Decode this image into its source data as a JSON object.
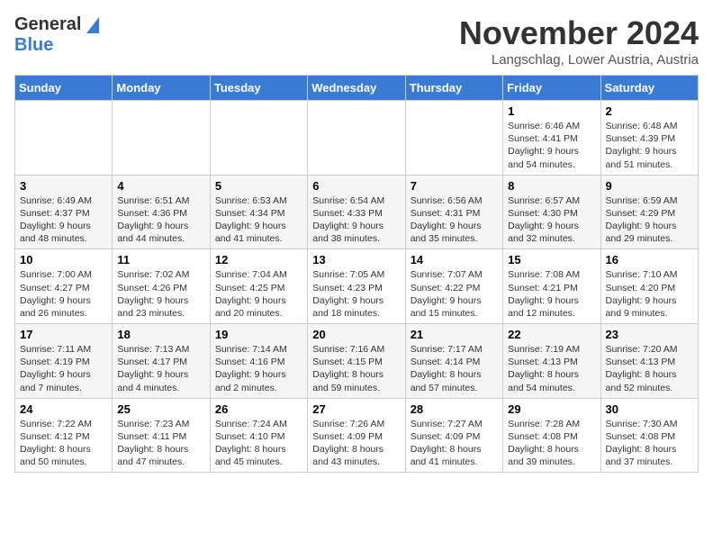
{
  "header": {
    "logo_general": "General",
    "logo_blue": "Blue",
    "month": "November 2024",
    "location": "Langschlag, Lower Austria, Austria"
  },
  "days_of_week": [
    "Sunday",
    "Monday",
    "Tuesday",
    "Wednesday",
    "Thursday",
    "Friday",
    "Saturday"
  ],
  "weeks": [
    [
      {
        "day": "",
        "info": ""
      },
      {
        "day": "",
        "info": ""
      },
      {
        "day": "",
        "info": ""
      },
      {
        "day": "",
        "info": ""
      },
      {
        "day": "",
        "info": ""
      },
      {
        "day": "1",
        "info": "Sunrise: 6:46 AM\nSunset: 4:41 PM\nDaylight: 9 hours\nand 54 minutes."
      },
      {
        "day": "2",
        "info": "Sunrise: 6:48 AM\nSunset: 4:39 PM\nDaylight: 9 hours\nand 51 minutes."
      }
    ],
    [
      {
        "day": "3",
        "info": "Sunrise: 6:49 AM\nSunset: 4:37 PM\nDaylight: 9 hours\nand 48 minutes."
      },
      {
        "day": "4",
        "info": "Sunrise: 6:51 AM\nSunset: 4:36 PM\nDaylight: 9 hours\nand 44 minutes."
      },
      {
        "day": "5",
        "info": "Sunrise: 6:53 AM\nSunset: 4:34 PM\nDaylight: 9 hours\nand 41 minutes."
      },
      {
        "day": "6",
        "info": "Sunrise: 6:54 AM\nSunset: 4:33 PM\nDaylight: 9 hours\nand 38 minutes."
      },
      {
        "day": "7",
        "info": "Sunrise: 6:56 AM\nSunset: 4:31 PM\nDaylight: 9 hours\nand 35 minutes."
      },
      {
        "day": "8",
        "info": "Sunrise: 6:57 AM\nSunset: 4:30 PM\nDaylight: 9 hours\nand 32 minutes."
      },
      {
        "day": "9",
        "info": "Sunrise: 6:59 AM\nSunset: 4:29 PM\nDaylight: 9 hours\nand 29 minutes."
      }
    ],
    [
      {
        "day": "10",
        "info": "Sunrise: 7:00 AM\nSunset: 4:27 PM\nDaylight: 9 hours\nand 26 minutes."
      },
      {
        "day": "11",
        "info": "Sunrise: 7:02 AM\nSunset: 4:26 PM\nDaylight: 9 hours\nand 23 minutes."
      },
      {
        "day": "12",
        "info": "Sunrise: 7:04 AM\nSunset: 4:25 PM\nDaylight: 9 hours\nand 20 minutes."
      },
      {
        "day": "13",
        "info": "Sunrise: 7:05 AM\nSunset: 4:23 PM\nDaylight: 9 hours\nand 18 minutes."
      },
      {
        "day": "14",
        "info": "Sunrise: 7:07 AM\nSunset: 4:22 PM\nDaylight: 9 hours\nand 15 minutes."
      },
      {
        "day": "15",
        "info": "Sunrise: 7:08 AM\nSunset: 4:21 PM\nDaylight: 9 hours\nand 12 minutes."
      },
      {
        "day": "16",
        "info": "Sunrise: 7:10 AM\nSunset: 4:20 PM\nDaylight: 9 hours\nand 9 minutes."
      }
    ],
    [
      {
        "day": "17",
        "info": "Sunrise: 7:11 AM\nSunset: 4:19 PM\nDaylight: 9 hours\nand 7 minutes."
      },
      {
        "day": "18",
        "info": "Sunrise: 7:13 AM\nSunset: 4:17 PM\nDaylight: 9 hours\nand 4 minutes."
      },
      {
        "day": "19",
        "info": "Sunrise: 7:14 AM\nSunset: 4:16 PM\nDaylight: 9 hours\nand 2 minutes."
      },
      {
        "day": "20",
        "info": "Sunrise: 7:16 AM\nSunset: 4:15 PM\nDaylight: 8 hours\nand 59 minutes."
      },
      {
        "day": "21",
        "info": "Sunrise: 7:17 AM\nSunset: 4:14 PM\nDaylight: 8 hours\nand 57 minutes."
      },
      {
        "day": "22",
        "info": "Sunrise: 7:19 AM\nSunset: 4:13 PM\nDaylight: 8 hours\nand 54 minutes."
      },
      {
        "day": "23",
        "info": "Sunrise: 7:20 AM\nSunset: 4:13 PM\nDaylight: 8 hours\nand 52 minutes."
      }
    ],
    [
      {
        "day": "24",
        "info": "Sunrise: 7:22 AM\nSunset: 4:12 PM\nDaylight: 8 hours\nand 50 minutes."
      },
      {
        "day": "25",
        "info": "Sunrise: 7:23 AM\nSunset: 4:11 PM\nDaylight: 8 hours\nand 47 minutes."
      },
      {
        "day": "26",
        "info": "Sunrise: 7:24 AM\nSunset: 4:10 PM\nDaylight: 8 hours\nand 45 minutes."
      },
      {
        "day": "27",
        "info": "Sunrise: 7:26 AM\nSunset: 4:09 PM\nDaylight: 8 hours\nand 43 minutes."
      },
      {
        "day": "28",
        "info": "Sunrise: 7:27 AM\nSunset: 4:09 PM\nDaylight: 8 hours\nand 41 minutes."
      },
      {
        "day": "29",
        "info": "Sunrise: 7:28 AM\nSunset: 4:08 PM\nDaylight: 8 hours\nand 39 minutes."
      },
      {
        "day": "30",
        "info": "Sunrise: 7:30 AM\nSunset: 4:08 PM\nDaylight: 8 hours\nand 37 minutes."
      }
    ]
  ]
}
